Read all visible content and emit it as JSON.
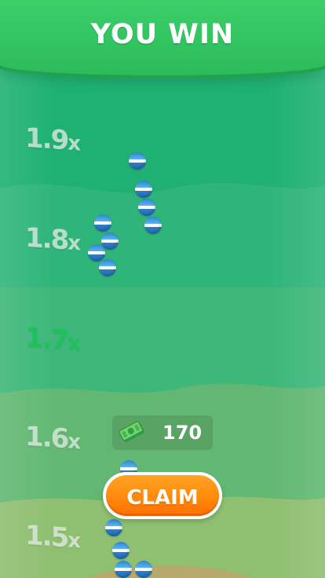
{
  "header": {
    "title": "YOU WIN"
  },
  "multipliers": [
    {
      "value": "1.9",
      "suffix": "x",
      "active": false
    },
    {
      "value": "1.8",
      "suffix": "x",
      "active": false
    },
    {
      "value": "1.7",
      "suffix": "x",
      "active": true
    },
    {
      "value": "1.6",
      "suffix": "x",
      "active": false
    },
    {
      "value": "1.5",
      "suffix": "x",
      "active": false
    }
  ],
  "reward": {
    "icon": "cash-stack-icon",
    "amount": "170"
  },
  "claim_button": {
    "label": "CLAIM"
  },
  "colors": {
    "header": "#34c863",
    "active_multiplier": "#20c15c",
    "claim_button": "#ff8a0c",
    "ball_stripe": "#2f86cf"
  }
}
